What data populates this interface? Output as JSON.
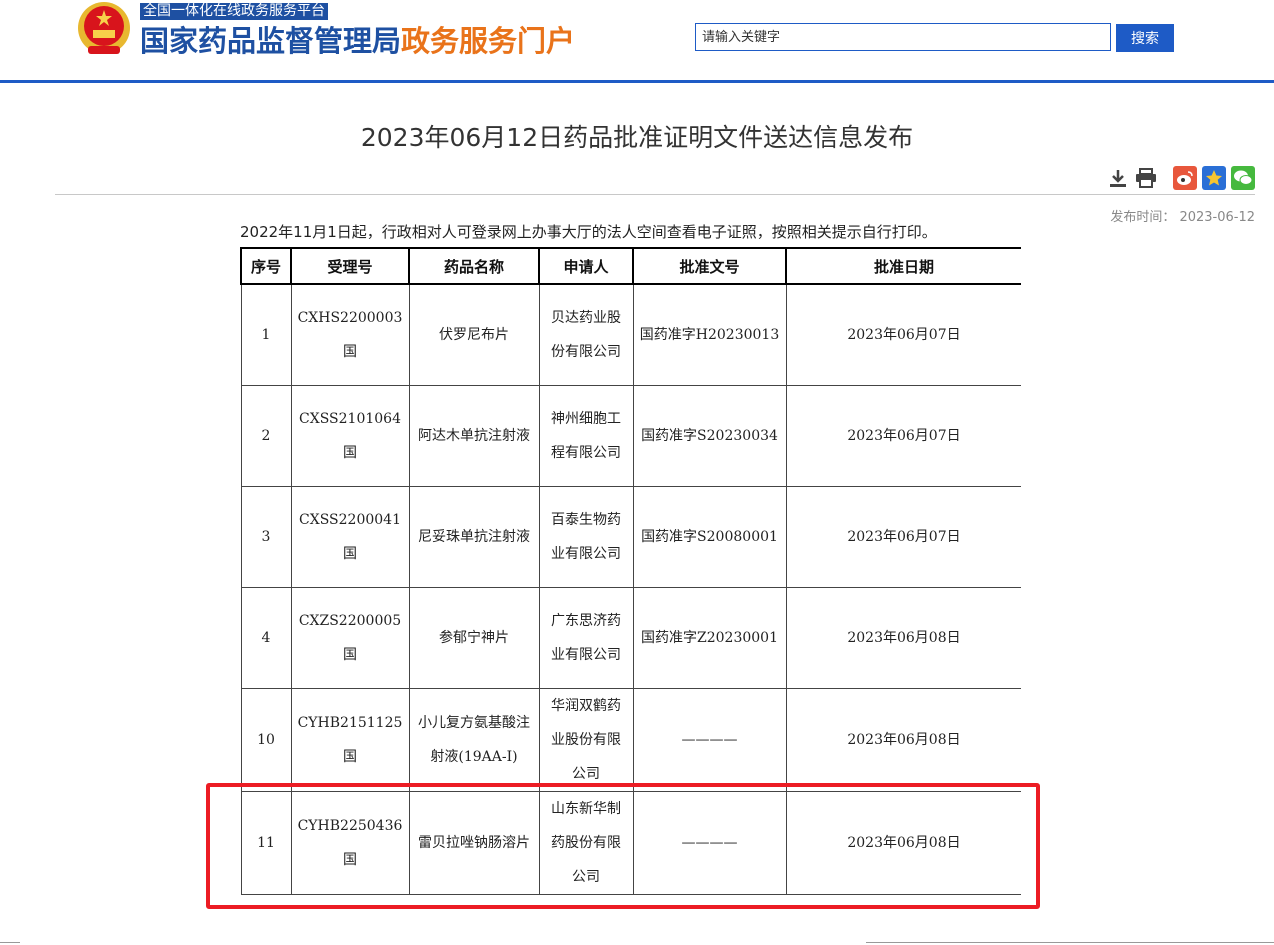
{
  "header": {
    "subtitle": "全国一体化在线政务服务平台",
    "site_name_main": "国家药品监督管理局",
    "site_name_accent": "政务服务门户",
    "search_placeholder": "请输入关键字",
    "search_button": "搜索"
  },
  "article": {
    "title": "2023年06月12日药品批准证明文件送达信息发布",
    "publish_label": "发布时间：",
    "publish_date": "2023-06-12",
    "notice": "2022年11月1日起，行政相对人可登录网上办事大厅的法人空间查看电子证照，按照相关提示自行打印。"
  },
  "toolbar": {
    "icons": [
      "download-icon",
      "print-icon",
      "weibo-icon",
      "favorite-star-icon",
      "wechat-icon"
    ]
  },
  "table": {
    "headers": [
      "序号",
      "受理号",
      "药品名称",
      "申请人",
      "批准文号",
      "批准日期"
    ],
    "rows": [
      {
        "no": "1",
        "accept_no": "CXHS2200003国",
        "drug": "伏罗尼布片",
        "applicant": "贝达药业股份有限公司",
        "approval_no": "国药准字H20230013",
        "date": "2023年06月07日"
      },
      {
        "no": "2",
        "accept_no": "CXSS2101064国",
        "drug": "阿达木单抗注射液",
        "applicant": "神州细胞工程有限公司",
        "approval_no": "国药准字S20230034",
        "date": "2023年06月07日"
      },
      {
        "no": "3",
        "accept_no": "CXSS2200041国",
        "drug": "尼妥珠单抗注射液",
        "applicant": "百泰生物药业有限公司",
        "approval_no": "国药准字S20080001",
        "date": "2023年06月07日"
      },
      {
        "no": "4",
        "accept_no": "CXZS2200005国",
        "drug": "参郁宁神片",
        "applicant": "广东思济药业有限公司",
        "approval_no": "国药准字Z20230001",
        "date": "2023年06月08日"
      },
      {
        "no": "10",
        "accept_no": "CYHB2151125国",
        "drug": "小儿复方氨基酸注射液(19AA-Ⅰ)",
        "applicant": "华润双鹤药业股份有限公司",
        "approval_no": "————",
        "date": "2023年06月08日"
      },
      {
        "no": "11",
        "accept_no": "CYHB2250436国",
        "drug": "雷贝拉唑钠肠溶片",
        "applicant": "山东新华制药股份有限公司",
        "approval_no": "————",
        "date": "2023年06月08日"
      }
    ]
  },
  "colors": {
    "brand_blue": "#1e50a2",
    "accent_orange": "#e9731a",
    "highlight_red": "#ec1c24"
  }
}
